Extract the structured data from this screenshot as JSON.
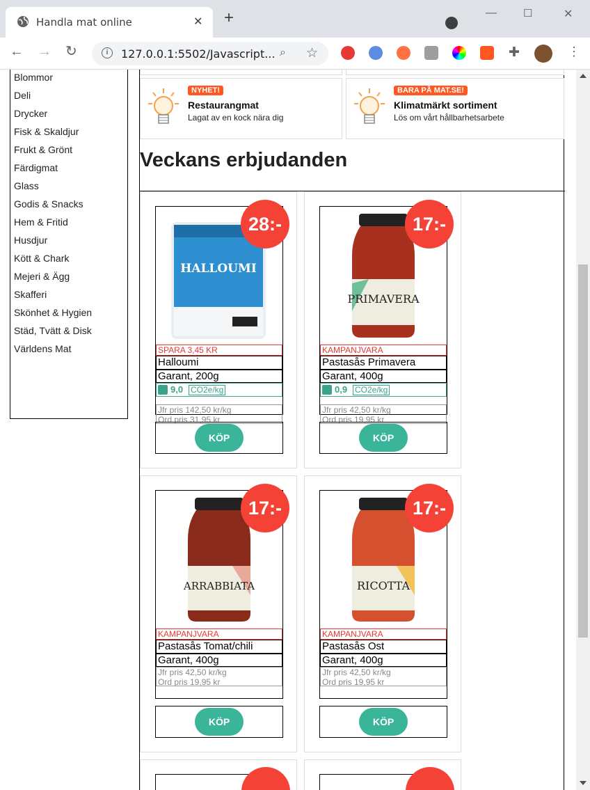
{
  "browser": {
    "tab_title": "Handla mat online",
    "url": "127.0.0.1:5502/Javascript...",
    "colors": {
      "tabbar": "#dee1e6"
    }
  },
  "sidebar": {
    "items": [
      {
        "label": "Blommor"
      },
      {
        "label": "Deli"
      },
      {
        "label": "Drycker"
      },
      {
        "label": "Fisk & Skaldjur"
      },
      {
        "label": "Frukt & Grönt"
      },
      {
        "label": "Färdigmat"
      },
      {
        "label": "Glass"
      },
      {
        "label": "Godis & Snacks"
      },
      {
        "label": "Hem & Fritid"
      },
      {
        "label": "Husdjur"
      },
      {
        "label": "Kött & Chark"
      },
      {
        "label": "Mejeri & Ägg"
      },
      {
        "label": "Skafferi"
      },
      {
        "label": "Skönhet & Hygien"
      },
      {
        "label": "Städ, Tvätt & Disk"
      },
      {
        "label": "Världens Mat"
      }
    ]
  },
  "promos": [
    {
      "badge": "NYHET!",
      "title": "Restaurangmat",
      "subtitle": "Lagat av en kock nära dig",
      "icon": "lightbulb-icon"
    },
    {
      "badge": "BARA PÅ MAT.SE!",
      "title": "Klimatmärkt sortiment",
      "subtitle": "Lös om vårt hållbarhetsarbete",
      "icon": "lightbulb-icon"
    }
  ],
  "section_title": "Veckans erbjudanden",
  "products": [
    {
      "price": "28:-",
      "tag": "SPARA 3,45 KR",
      "name": "Halloumi",
      "brand": "Garant, 200g",
      "co2_value": "9,0",
      "co2_unit": "CO2e/kg",
      "compare_price": "Jfr pris 142,50 kr/kg",
      "ordinary_price": "Ord pris 31,95 kr",
      "buy_label": "KÖP",
      "image": "halloumi-package-image"
    },
    {
      "price": "17:-",
      "tag": "KAMPANJVARA",
      "name": "Pastasås Primavera",
      "brand": "Garant, 400g",
      "co2_value": "0,9",
      "co2_unit": "CO2e/kg",
      "compare_price": "Jfr pris 42,50 kr/kg",
      "ordinary_price": "Ord pris 19,95 kr",
      "buy_label": "KÖP",
      "image": "primavera-jar-image"
    },
    {
      "price": "17:-",
      "tag": "KAMPANJVARA",
      "name": "Pastasås Tomat/chili",
      "brand": "Garant, 400g",
      "compare_price": "Jfr pris 42,50 kr/kg",
      "ordinary_price": "Ord pris 19,95 kr",
      "buy_label": "KÖP",
      "image": "arrabbiata-jar-image"
    },
    {
      "price": "17:-",
      "tag": "KAMPANJVARA",
      "name": "Pastasås Ost",
      "brand": "Garant, 400g",
      "compare_price": "Jfr pris 42,50 kr/kg",
      "ordinary_price": "Ord pris 19,95 kr",
      "buy_label": "KÖP",
      "image": "ricotta-jar-image"
    }
  ],
  "colors": {
    "price_badge": "#f44336",
    "buy_button": "#3ab59a",
    "campaign": "#e53935",
    "co2": "#3aa38a",
    "promo_badge": "#ff5722"
  }
}
